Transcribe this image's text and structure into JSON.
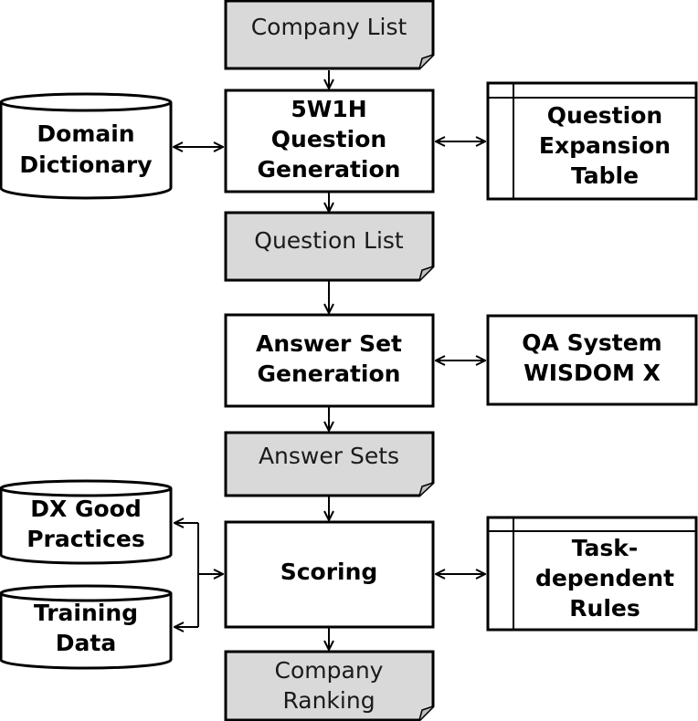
{
  "diagram": {
    "documents": {
      "company_list": [
        "Company List"
      ],
      "question_list": [
        "Question List"
      ],
      "answer_sets": [
        "Answer Sets"
      ],
      "company_ranking": [
        "Company",
        "Ranking"
      ]
    },
    "processes": {
      "question_generation": [
        "5W1H",
        "Question",
        "Generation"
      ],
      "answer_set_generation": [
        "Answer Set",
        "Generation"
      ],
      "scoring": [
        "Scoring"
      ]
    },
    "databases": {
      "domain_dictionary": [
        "Domain",
        "Dictionary"
      ],
      "dx_good_practices": [
        "DX Good",
        "Practices"
      ],
      "training_data": [
        "Training",
        "Data"
      ]
    },
    "tables": {
      "question_expansion_table": [
        "Question",
        "Expansion",
        "Table"
      ],
      "task_dependent_rules": [
        "Task-",
        "dependent",
        "Rules"
      ]
    },
    "systems": {
      "qa_system": [
        "QA System",
        "WISDOM X"
      ]
    },
    "colors": {
      "document_fill": "#d9d9d9",
      "stroke": "#000000",
      "box_fill": "#ffffff"
    }
  }
}
